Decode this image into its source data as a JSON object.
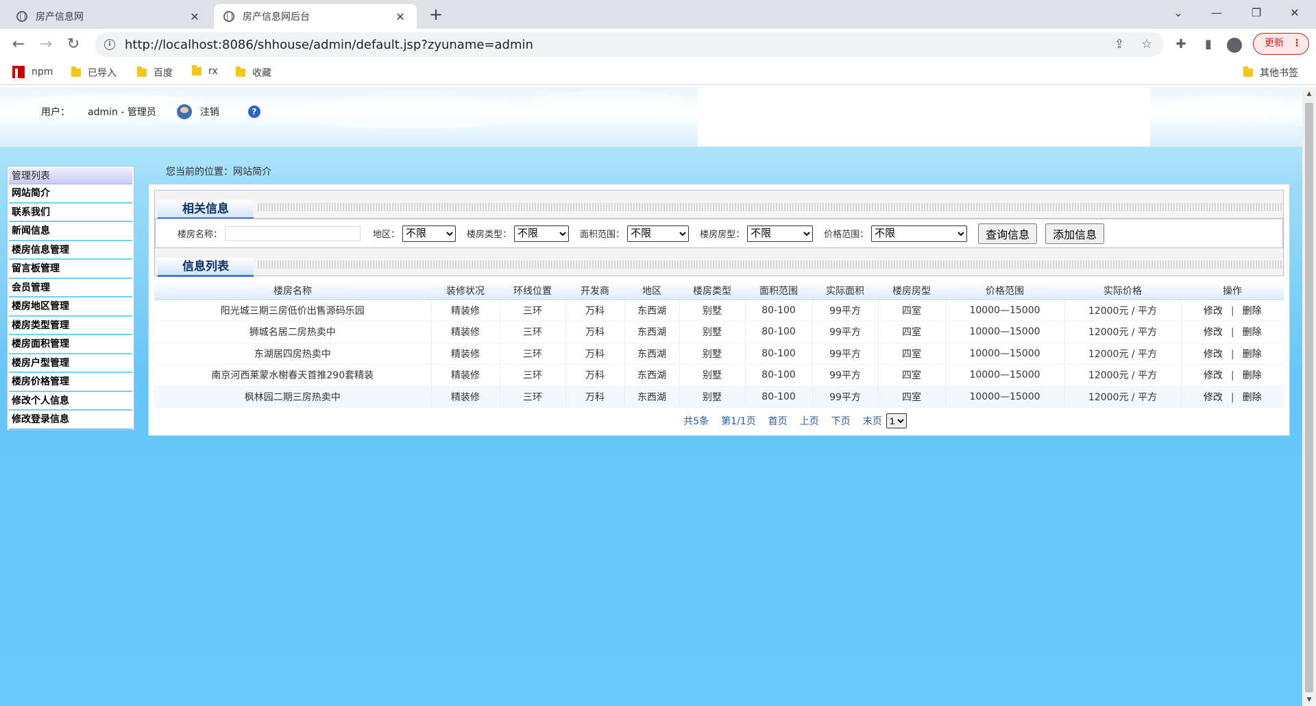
{
  "browser": {
    "tabs": [
      {
        "title": "房产信息网",
        "active": false
      },
      {
        "title": "房产信息网后台",
        "active": true
      }
    ],
    "url": "http://localhost:8086/shhouse/admin/default.jsp?zyuname=admin",
    "update_label": "更新",
    "bookmarks": [
      "npm",
      "已导入",
      "百度",
      "rx",
      "收藏"
    ],
    "other_bookmarks": "其他书签"
  },
  "header": {
    "user_label": "用户：",
    "user_name": "admin - 管理员",
    "logout": "注销"
  },
  "sidebar": {
    "title": "管理列表",
    "items": [
      "网站简介",
      "联系我们",
      "新闻信息",
      "楼房信息管理",
      "留言板管理",
      "会员管理",
      "楼房地区管理",
      "楼房类型管理",
      "楼房面积管理",
      "楼房户型管理",
      "楼房价格管理",
      "修改个人信息",
      "修改登录信息"
    ]
  },
  "location": "您当前的位置：网站简介",
  "search": {
    "section_title": "相关信息",
    "name_label": "楼房名称：",
    "name_value": "",
    "area_label": "地区：",
    "type_label": "楼房类型：",
    "size_label": "面积范围：",
    "layout_label": "楼房房型：",
    "price_label": "价格范围：",
    "default_option": "不限",
    "query_button": "查询信息",
    "add_button": "添加信息"
  },
  "list": {
    "section_title": "信息列表",
    "columns": [
      "楼房名称",
      "装修状况",
      "环线位置",
      "开发商",
      "地区",
      "楼房类型",
      "面积范围",
      "实际面积",
      "楼房房型",
      "价格范围",
      "实际价格",
      "操作"
    ],
    "rows": [
      [
        "阳光城三期三房低价出售源码乐园",
        "精装修",
        "三环",
        "万科",
        "东西湖",
        "别墅",
        "80-100",
        "99平方",
        "四室",
        "10000—15000",
        "12000元 / 平方"
      ],
      [
        "狮城名居二房热卖中",
        "精装修",
        "三环",
        "万科",
        "东西湖",
        "别墅",
        "80-100",
        "99平方",
        "四室",
        "10000—15000",
        "12000元 / 平方"
      ],
      [
        "东湖居四房热卖中",
        "精装修",
        "三环",
        "万科",
        "东西湖",
        "别墅",
        "80-100",
        "99平方",
        "四室",
        "10000—15000",
        "12000元 / 平方"
      ],
      [
        "南京河西莱蒙水榭春天首推290套精装",
        "精装修",
        "三环",
        "万科",
        "东西湖",
        "别墅",
        "80-100",
        "99平方",
        "四室",
        "10000—15000",
        "12000元 / 平方"
      ],
      [
        "枫林园二期三房热卖中",
        "精装修",
        "三环",
        "万科",
        "东西湖",
        "别墅",
        "80-100",
        "99平方",
        "四室",
        "10000—15000",
        "12000元 / 平方"
      ]
    ],
    "edit_label": "修改",
    "op_separator": "|",
    "delete_label": "删除"
  },
  "pager": {
    "total": "共5条",
    "page_info": "第1/1页",
    "first": "首页",
    "prev": "上页",
    "next": "下页",
    "last": "末页",
    "page_select": "1"
  }
}
